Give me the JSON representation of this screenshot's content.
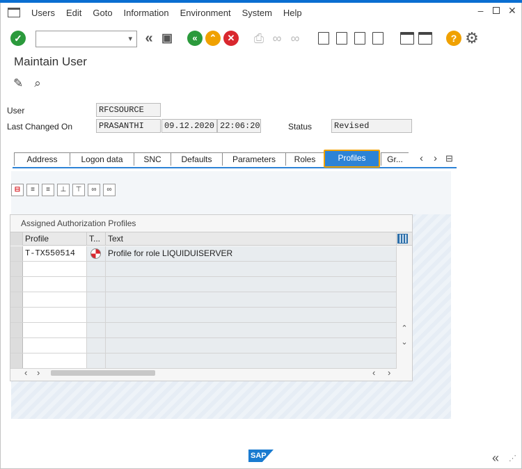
{
  "menu": {
    "items": [
      "Users",
      "Edit",
      "Goto",
      "Information",
      "Environment",
      "System",
      "Help"
    ]
  },
  "toolbar": {
    "command_value": "",
    "icons": {
      "enter": "checkmark-icon",
      "back_nav": "double-chevron-left-icon",
      "save": "save-icon",
      "back": "green-back-icon",
      "exit": "orange-up-icon",
      "cancel": "red-cancel-icon",
      "print": "print-icon",
      "find": "binoculars-icon",
      "find_next": "binoculars-plus-icon",
      "first_page": "first-page-icon",
      "prev_page": "previous-page-icon",
      "next_page": "next-page-icon",
      "last_page": "last-page-icon",
      "new_session": "new-session-icon",
      "shortcut": "shortcut-icon",
      "help": "help-icon",
      "settings": "gear-icon"
    }
  },
  "title": "Maintain User",
  "header": {
    "user_label": "User",
    "user_value": "RFCSOURCE",
    "last_changed_label": "Last Changed On",
    "changed_by": "PRASANTHI",
    "changed_date": "09.12.2020",
    "changed_time": "22:06:20",
    "status_label": "Status",
    "status_value": "Revised"
  },
  "tabs": [
    {
      "label": "Address"
    },
    {
      "label": "Logon data"
    },
    {
      "label": "SNC"
    },
    {
      "label": "Defaults"
    },
    {
      "label": "Parameters"
    },
    {
      "label": "Roles"
    },
    {
      "label": "Profiles",
      "active": true
    },
    {
      "label": "Gr..."
    }
  ],
  "profiles_panel": {
    "title": "Assigned Authorization Profiles",
    "columns": [
      "Profile",
      "T...",
      "Text"
    ],
    "rows": [
      {
        "profile": "T-TX550514",
        "type_icon": "role-profile-icon",
        "text": "Profile for role LIQUIDUISERVER"
      }
    ]
  },
  "colors": {
    "accent": "#2c83d6",
    "highlight": "#f0a100",
    "ok_green": "#2b9a3c",
    "cancel_red": "#d9272e"
  },
  "status_bar": {
    "logo": "SAP"
  }
}
